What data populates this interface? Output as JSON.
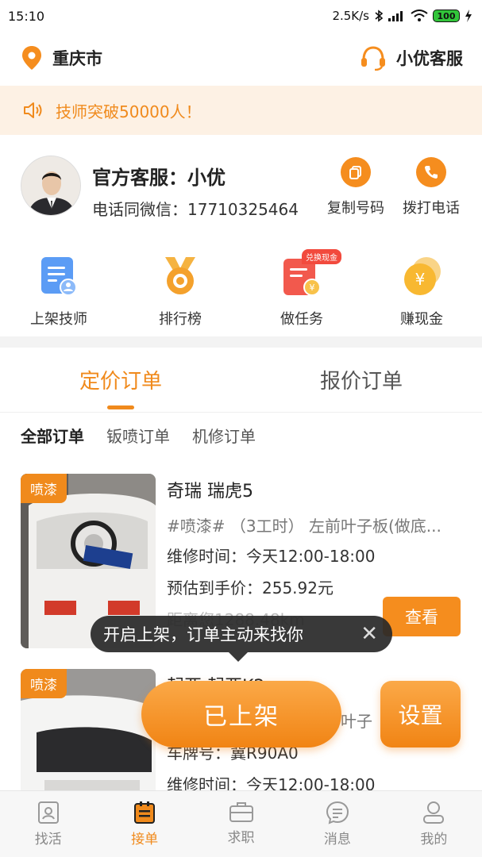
{
  "status_bar": {
    "time": "15:10",
    "network_speed": "2.5K/s",
    "battery": "100"
  },
  "header": {
    "city": "重庆市",
    "service_label": "小优客服"
  },
  "notice": {
    "text": "技师突破50000人！"
  },
  "contact": {
    "name": "官方客服：小优",
    "phone": "电话同微信：17710325464",
    "copy_label": "复制号码",
    "call_label": "拨打电话"
  },
  "features": [
    {
      "label": "上架技师",
      "icon": "technician-icon"
    },
    {
      "label": "排行榜",
      "icon": "medal-icon"
    },
    {
      "label": "做任务",
      "icon": "task-icon",
      "badge": "兑换现金"
    },
    {
      "label": "赚现金",
      "icon": "coin-icon"
    }
  ],
  "tabs": [
    {
      "label": "定价订单",
      "active": true
    },
    {
      "label": "报价订单",
      "active": false
    }
  ],
  "filters": [
    {
      "label": "全部订单",
      "selected": true
    },
    {
      "label": "钣喷订单",
      "selected": false
    },
    {
      "label": "机修订单",
      "selected": false
    }
  ],
  "orders": [
    {
      "tag": "喷漆",
      "title": "奇瑞 瑞虎5",
      "service": "#喷漆# （3工时） 左前叶子板(做底...",
      "time": "维修时间：今天12:00-18:00",
      "price": "预估到手价：255.92元",
      "distance": "距离您1288.48km",
      "view_label": "查看"
    },
    {
      "tag": "喷漆",
      "title": "起亚 起亚K2",
      "service": "#喷漆# （3工时） 右前叶子",
      "plate": "车牌号：冀R90A0",
      "time": "维修时间：今天12:00-18:00"
    }
  ],
  "tooltip": {
    "text": "开启上架，订单主动来找你"
  },
  "actions": {
    "online_label": "已上架",
    "settings_label": "设置"
  },
  "bottom_nav": [
    {
      "label": "找活",
      "active": false
    },
    {
      "label": "接单",
      "active": true
    },
    {
      "label": "求职",
      "active": false
    },
    {
      "label": "消息",
      "active": false
    },
    {
      "label": "我的",
      "active": false
    }
  ],
  "colors": {
    "accent": "#f08a1c",
    "notice_bg": "#fdf1e4",
    "badge_red": "#f24a3d"
  }
}
